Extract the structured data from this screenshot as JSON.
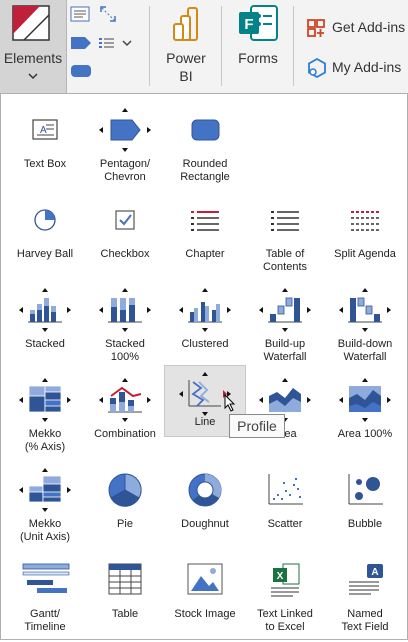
{
  "ribbon": {
    "elements_label": "Elements",
    "powerbi_label": "Power\nBI",
    "forms_label": "Forms",
    "get_addins_label": "Get Add-ins",
    "my_addins_label": "My Add-ins"
  },
  "colors": {
    "accent": "#4472c4",
    "accent_dark": "#2f5597",
    "red": "#c0203a",
    "highlight": "#e3e3e3"
  },
  "gallery": {
    "items": [
      {
        "id": "text-box",
        "label": "Text Box"
      },
      {
        "id": "pentagon-chevron",
        "label": "Pentagon/\nChevron"
      },
      {
        "id": "rounded-rectangle",
        "label": "Rounded\nRectangle"
      },
      {
        "id": "harvey-ball",
        "label": "Harvey Ball"
      },
      {
        "id": "checkbox",
        "label": "Checkbox"
      },
      {
        "id": "chapter",
        "label": "Chapter"
      },
      {
        "id": "table-of-contents",
        "label": "Table of\nContents"
      },
      {
        "id": "split-agenda",
        "label": "Split Agenda"
      },
      {
        "id": "stacked",
        "label": "Stacked"
      },
      {
        "id": "stacked-100",
        "label": "Stacked\n100%"
      },
      {
        "id": "clustered",
        "label": "Clustered"
      },
      {
        "id": "build-up-waterfall",
        "label": "Build-up\nWaterfall"
      },
      {
        "id": "build-down-waterfall",
        "label": "Build-down\nWaterfall"
      },
      {
        "id": "mekko-axis",
        "label": "Mekko\n(% Axis)"
      },
      {
        "id": "combination",
        "label": "Combination"
      },
      {
        "id": "line",
        "label": "Line"
      },
      {
        "id": "area",
        "label": "Area"
      },
      {
        "id": "area-100",
        "label": "Area 100%"
      },
      {
        "id": "mekko-unit",
        "label": "Mekko\n(Unit Axis)"
      },
      {
        "id": "pie",
        "label": "Pie"
      },
      {
        "id": "doughnut",
        "label": "Doughnut"
      },
      {
        "id": "scatter",
        "label": "Scatter"
      },
      {
        "id": "bubble",
        "label": "Bubble"
      },
      {
        "id": "gantt",
        "label": "Gantt/\nTimeline"
      },
      {
        "id": "table",
        "label": "Table"
      },
      {
        "id": "stock-image",
        "label": "Stock Image"
      },
      {
        "id": "text-linked-excel",
        "label": "Text Linked\nto Excel"
      },
      {
        "id": "named-text-field",
        "label": "Named\nText Field"
      }
    ]
  },
  "tooltip": {
    "text": "Profile"
  }
}
